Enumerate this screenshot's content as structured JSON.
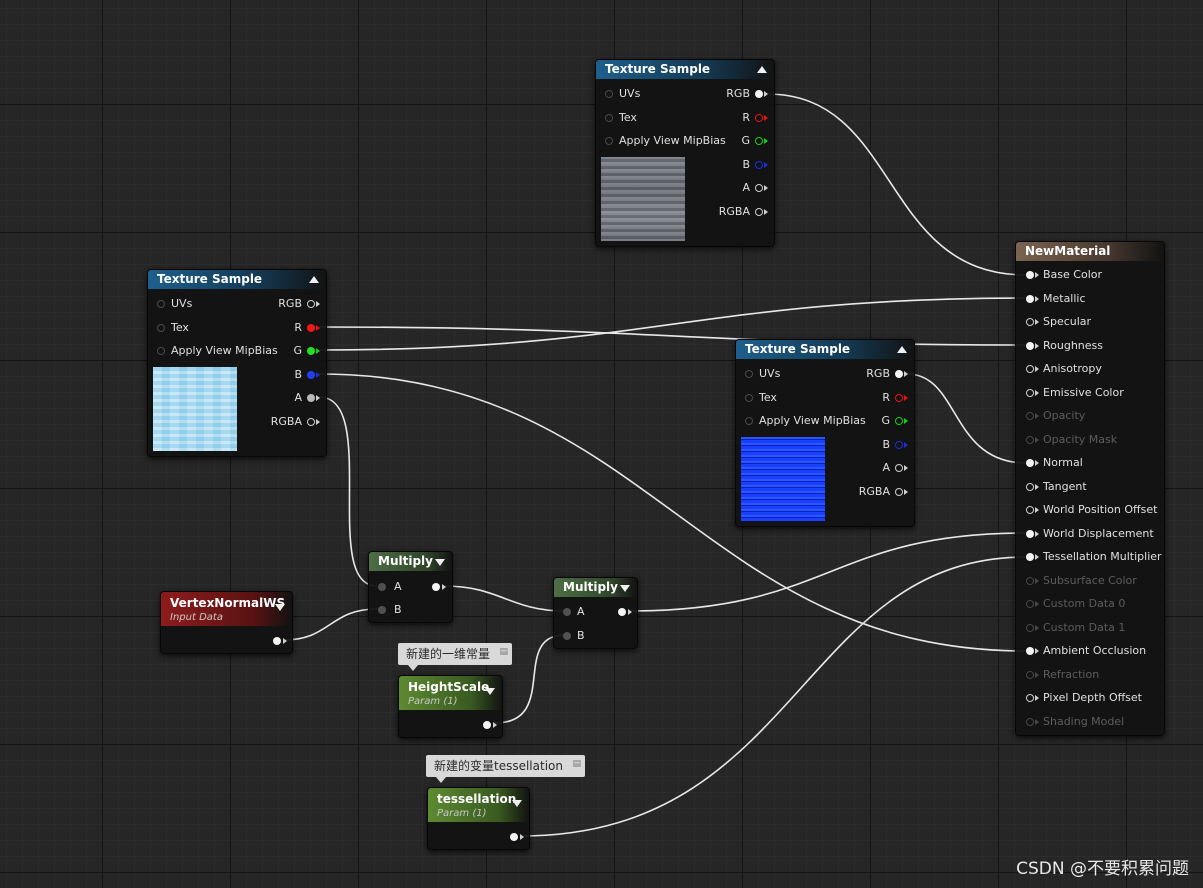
{
  "nodes": {
    "tex_top": {
      "title": "Texture Sample",
      "inputs": [
        "UVs",
        "Tex",
        "Apply View MipBias"
      ],
      "outputs": [
        "RGB",
        "R",
        "G",
        "B",
        "A",
        "RGBA"
      ]
    },
    "tex_left": {
      "title": "Texture Sample",
      "inputs": [
        "UVs",
        "Tex",
        "Apply View MipBias"
      ],
      "outputs": [
        "RGB",
        "R",
        "G",
        "B",
        "A",
        "RGBA"
      ]
    },
    "tex_mid": {
      "title": "Texture Sample",
      "inputs": [
        "UVs",
        "Tex",
        "Apply View MipBias"
      ],
      "outputs": [
        "RGB",
        "R",
        "G",
        "B",
        "A",
        "RGBA"
      ]
    },
    "multiply_1": {
      "title": "Multiply",
      "inputs": [
        "A",
        "B"
      ]
    },
    "multiply_2": {
      "title": "Multiply",
      "inputs": [
        "A",
        "B"
      ]
    },
    "vertex_normal": {
      "title": "VertexNormalWS",
      "subtitle": "Input Data"
    },
    "height_scale": {
      "title": "HeightScale",
      "subtitle": "Param (1)"
    },
    "tessellation": {
      "title": "tessellation",
      "subtitle": "Param (1)"
    },
    "material": {
      "title": "NewMaterial",
      "inputs": [
        "Base Color",
        "Metallic",
        "Specular",
        "Roughness",
        "Anisotropy",
        "Emissive Color",
        "Opacity",
        "Opacity Mask",
        "Normal",
        "Tangent",
        "World Position Offset",
        "World Displacement",
        "Tessellation Multiplier",
        "Subsurface Color",
        "Custom Data 0",
        "Custom Data 1",
        "Ambient Occlusion",
        "Refraction",
        "Pixel Depth Offset",
        "Shading Model"
      ]
    }
  },
  "comments": {
    "height_scale": "新建的一维常量",
    "tessellation": "新建的变量tessellation"
  },
  "watermark": "CSDN @不要积累问题"
}
